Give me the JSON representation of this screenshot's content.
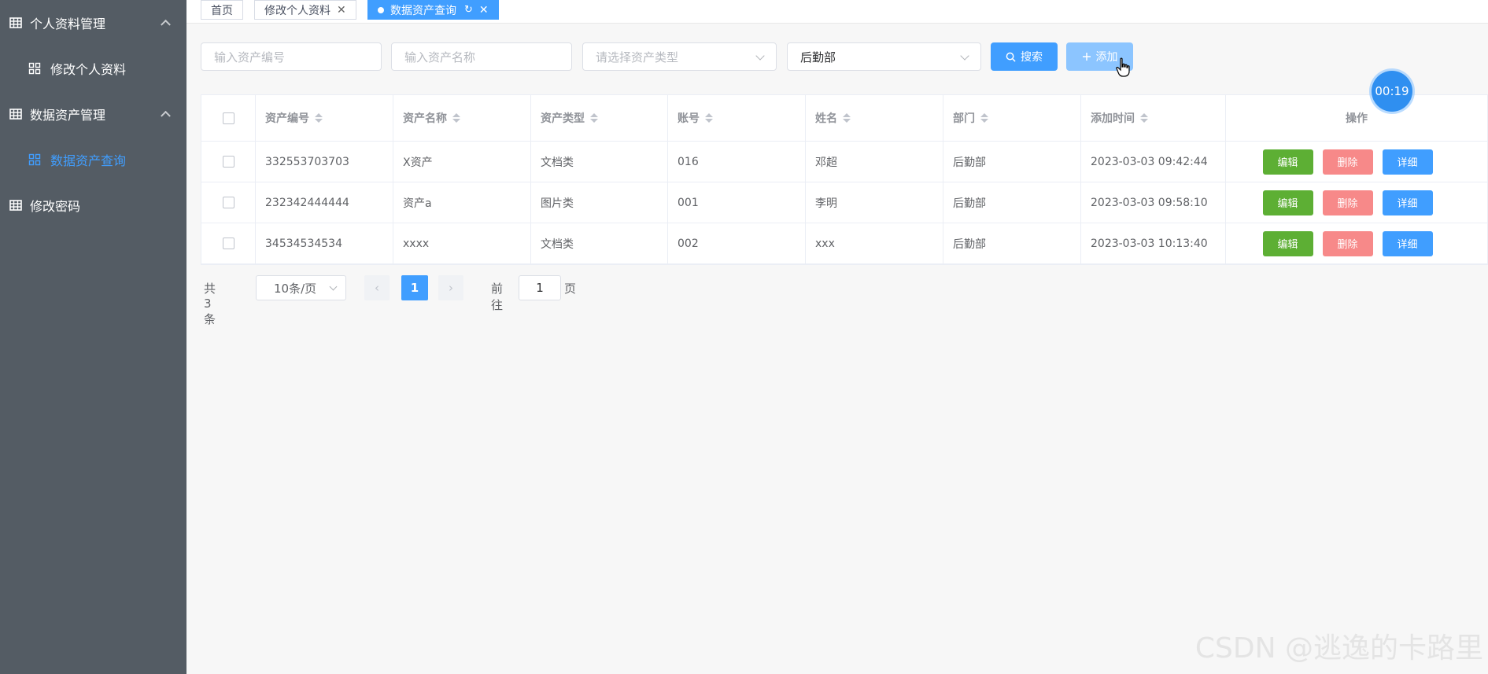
{
  "sidebar": {
    "groups": [
      {
        "label": "个人资料管理"
      },
      {
        "label": "数据资产管理"
      }
    ],
    "subs": [
      {
        "label": "修改个人资料"
      },
      {
        "label": "数据资产查询"
      }
    ],
    "single": {
      "label": "修改密码"
    }
  },
  "tabs": [
    {
      "label": "首页"
    },
    {
      "label": "修改个人资料"
    },
    {
      "label": "数据资产查询"
    }
  ],
  "filters": {
    "asset_no_placeholder": "输入资产编号",
    "asset_name_placeholder": "输入资产名称",
    "asset_type_placeholder": "请选择资产类型",
    "department_value": "后勤部",
    "search_label": "搜索",
    "add_label": "添加"
  },
  "table": {
    "headers": [
      "资产编号",
      "资产名称",
      "资产类型",
      "账号",
      "姓名",
      "部门",
      "添加时间",
      "操作"
    ],
    "rows": [
      {
        "asset_no": "332553703703",
        "name": "X资产",
        "type": "文档类",
        "account": "016",
        "person": "邓超",
        "dept": "后勤部",
        "time": "2023-03-03 09:42:44"
      },
      {
        "asset_no": "232342444444",
        "name": "资产a",
        "type": "图片类",
        "account": "001",
        "person": "李明",
        "dept": "后勤部",
        "time": "2023-03-03 09:58:10"
      },
      {
        "asset_no": "34534534534",
        "name": "xxxx",
        "type": "文档类",
        "account": "002",
        "person": "xxx",
        "dept": "后勤部",
        "time": "2023-03-03 10:13:40"
      }
    ],
    "actions": {
      "edit": "编辑",
      "delete": "删除",
      "detail": "详细"
    }
  },
  "pagination": {
    "total": "共 3 条",
    "page_size": "10条/页",
    "current_page": "1",
    "goto_label": "前往",
    "goto_value": "1",
    "page_suffix": "页"
  },
  "timer": "00:19",
  "watermark": "CSDN @逃逸的卡路里",
  "colors": {
    "primary": "#409eff",
    "sidebar": "#545c64",
    "edit": "#5daf34",
    "delete": "#f78989"
  }
}
